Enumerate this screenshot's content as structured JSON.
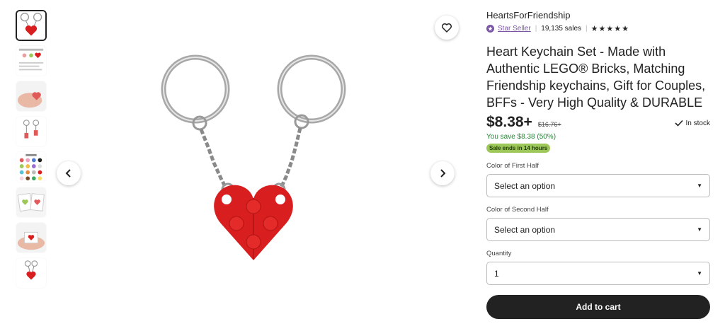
{
  "gallery": {
    "thumbnails": [
      {
        "icon": "keychain-heart-thumb",
        "active": true
      },
      {
        "icon": "info-card-thumb",
        "active": false
      },
      {
        "icon": "hand-heart-thumb",
        "active": false
      },
      {
        "icon": "keychain-pair-thumb",
        "active": false
      },
      {
        "icon": "color-chart-thumb",
        "active": false
      },
      {
        "icon": "gift-card-thumb",
        "active": false
      },
      {
        "icon": "hand-box-thumb",
        "active": false
      },
      {
        "icon": "keychain-small-thumb",
        "active": false
      }
    ]
  },
  "shop": {
    "name": "HeartsForFriendship",
    "star_seller": "Star Seller",
    "sales": "19,135 sales",
    "rating_stars": "★★★★★"
  },
  "product": {
    "title": "Heart Keychain Set - Made with Authentic LEGO® Bricks, Matching Friendship keychains, Gift for Couples, BFFs - Very High Quality & DURABLE",
    "price": "$8.38+",
    "original_price": "$16.76+",
    "stock": "In stock",
    "savings": "You save $8.38 (50%)",
    "sale_badge": "Sale ends in 14 hours"
  },
  "options": {
    "first_label": "Color of First Half",
    "first_value": "Select an option",
    "second_label": "Color of Second Half",
    "second_value": "Select an option",
    "quantity_label": "Quantity",
    "quantity_value": "1"
  },
  "cart": {
    "label": "Add to cart"
  },
  "colors": {
    "heart_red": "#d81e1e",
    "star_seller": "#7b55a5",
    "savings_green": "#258635",
    "sale_badge": "#9ec75a",
    "button_dark": "#222222"
  }
}
